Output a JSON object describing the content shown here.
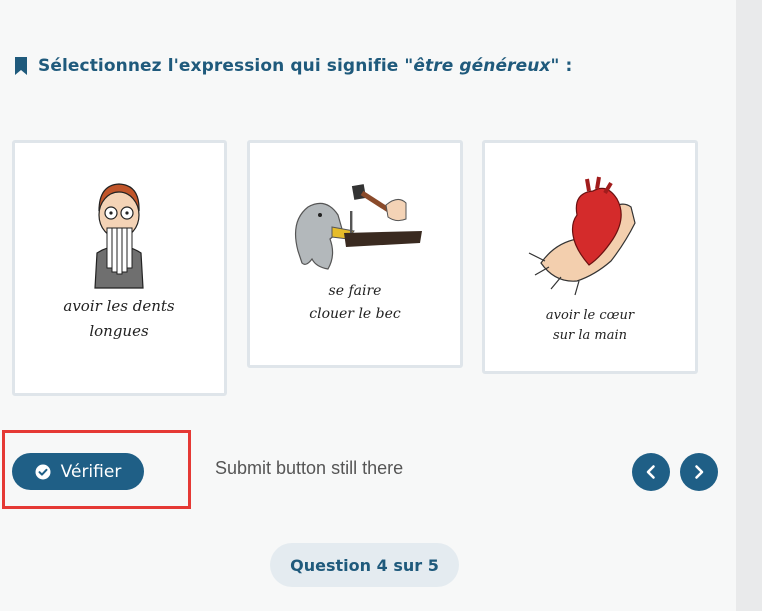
{
  "question": {
    "prompt_start": "Sélectionnez l'expression qui signifie ",
    "prompt_quote": "\"être généreux\"",
    "prompt_end": " :",
    "icon": "bookmark-icon"
  },
  "options": [
    {
      "caption_line1": "avoir les dents",
      "caption_line2": "longues"
    },
    {
      "caption_line1": "se faire",
      "caption_line2": "clouer le bec"
    },
    {
      "caption_line1": "avoir le cœur",
      "caption_line2": "sur la main"
    }
  ],
  "actions": {
    "verify_label": "Vérifier",
    "verify_icon": "check-circle-icon",
    "annotation": "Submit button still there",
    "prev_icon": "chevron-left-icon",
    "next_icon": "chevron-right-icon"
  },
  "progress": {
    "label": "Question 4 sur 5",
    "current": 4,
    "total": 5
  },
  "colors": {
    "primary": "#1f5f86",
    "highlight": "#e53935",
    "card_border": "#dfe5ea"
  }
}
